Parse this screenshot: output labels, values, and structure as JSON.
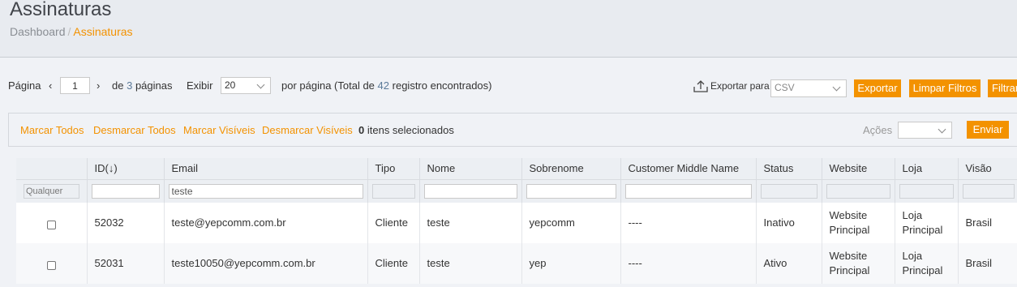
{
  "header": {
    "title": "Assinaturas",
    "breadcrumb": {
      "home": "Dashboard",
      "separator": "/",
      "current": "Assinaturas"
    }
  },
  "pager": {
    "page_label": "Página",
    "current_page": "1",
    "of_prefix": "de",
    "total_pages": "3",
    "pages_suffix": "páginas",
    "show_label": "Exibir",
    "per_page": "20",
    "per_page_prefix": "por página (Total de",
    "total_records": "42",
    "records_suffix": "registro encontrados)"
  },
  "export": {
    "label": "Exportar para",
    "format": "CSV",
    "export_button": "Exportar",
    "clear_filters_button": "Limpar Filtros",
    "filter_button": "Filtrar"
  },
  "mass_actions": {
    "select_all": "Marcar Todos",
    "unselect_all": "Desmarcar Todos",
    "select_visible": "Marcar Visíveis",
    "unselect_visible": "Desmarcar Visíveis",
    "selected_count": "0",
    "selected_label": "itens selecionados",
    "actions_label": "Ações",
    "actions_value": "",
    "submit_button": "Enviar"
  },
  "grid": {
    "columns": [
      "",
      "ID",
      "Email",
      "Tipo",
      "Nome",
      "Sobrenome",
      "Customer Middle Name",
      "Status",
      "Website",
      "Loja",
      "Visão"
    ],
    "sort_indicator": "(↓)",
    "filters": {
      "any": "Qualquer",
      "id": "",
      "email": "teste",
      "tipo": "",
      "nome": "",
      "sobrenome": "",
      "middle": "",
      "status": "",
      "website": "",
      "loja": "",
      "visao": ""
    },
    "rows": [
      {
        "id": "52032",
        "email": "teste@yepcomm.com.br",
        "tipo": "Cliente",
        "nome": "teste",
        "sobrenome": "yepcomm",
        "middle": "----",
        "status": "Inativo",
        "website_1": "Website",
        "website_2": "Principal",
        "loja_1": "Loja",
        "loja_2": "Principal",
        "visao": "Brasil"
      },
      {
        "id": "52031",
        "email": "teste10050@yepcomm.com.br",
        "tipo": "Cliente",
        "nome": "teste",
        "sobrenome": "yep",
        "middle": "----",
        "status": "Ativo",
        "website_1": "Website",
        "website_2": "Principal",
        "loja_1": "Loja",
        "loja_2": "Principal",
        "visao": "Brasil"
      }
    ]
  },
  "colors": {
    "accent": "#f39200",
    "link_blue": "#5b7a99",
    "header_bg": "#e8ebf0",
    "page_bg": "#f0f2f6"
  },
  "icons": {
    "prev": "chevron-left-icon",
    "next": "chevron-right-icon",
    "export": "upload-icon",
    "dropdown": "chevron-down-icon"
  }
}
